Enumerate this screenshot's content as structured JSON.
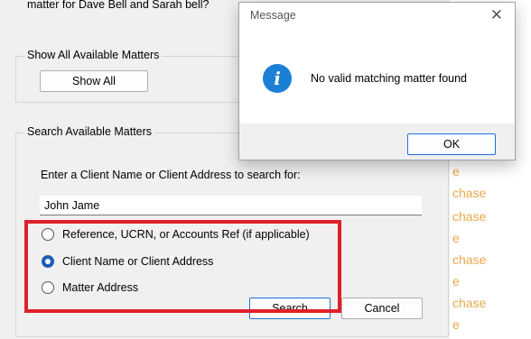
{
  "dialog": {
    "question": "matter for Dave Bell and Sarah bell?",
    "show_all_group": {
      "title": "Show All Available Matters",
      "button_label": "Show All"
    },
    "search_group": {
      "title": "Search Available Matters",
      "prompt": "Enter a Client Name or Client Address to search for:",
      "search_value": "John Jame",
      "options": [
        {
          "label": "Reference, UCRN, or Accounts Ref (if applicable)",
          "checked": false
        },
        {
          "label": "Client Name or Client Address",
          "checked": true
        },
        {
          "label": "Matter Address",
          "checked": false
        }
      ]
    },
    "search_button": "Search",
    "cancel_button": "Cancel"
  },
  "background_right": [
    "e",
    "chase",
    "chase",
    "e",
    "chase",
    "e",
    "chase",
    "e"
  ],
  "message_box": {
    "title": "Message",
    "text": "No valid matching matter found",
    "ok_label": "OK",
    "icon": "info-icon"
  },
  "colors": {
    "accent": "#1a5fb4",
    "highlight": "#e0202a",
    "link_orange": "#e8a84a"
  }
}
